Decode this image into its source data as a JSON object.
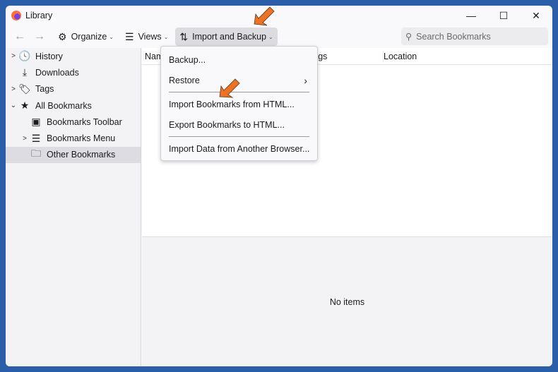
{
  "window": {
    "title": "Library",
    "min": "—",
    "max": "☐",
    "close": "✕"
  },
  "toolbar": {
    "back": "←",
    "forward": "→",
    "organize": "Organize",
    "views": "Views",
    "import_backup": "Import and Backup",
    "search_placeholder": "Search Bookmarks"
  },
  "sidebar": {
    "items": [
      {
        "label": "History",
        "icon": "clock-icon",
        "glyph": "🕓",
        "twisty": ">"
      },
      {
        "label": "Downloads",
        "icon": "download-icon",
        "glyph": "⤓",
        "twisty": ""
      },
      {
        "label": "Tags",
        "icon": "tag-icon",
        "glyph": "🏷",
        "twisty": ">"
      },
      {
        "label": "All Bookmarks",
        "icon": "star-icon",
        "glyph": "★",
        "twisty": "⌄"
      },
      {
        "label": "Bookmarks Toolbar",
        "icon": "toolbar-icon",
        "glyph": "▣",
        "twisty": ""
      },
      {
        "label": "Bookmarks Menu",
        "icon": "menu-icon",
        "glyph": "☰",
        "twisty": ">"
      },
      {
        "label": "Other Bookmarks",
        "icon": "folder-icon",
        "glyph": "🗀",
        "twisty": ""
      }
    ]
  },
  "columns": {
    "name": "Name",
    "tags": "Tags",
    "location": "Location"
  },
  "details": {
    "empty": "No items"
  },
  "menu": {
    "backup": "Backup...",
    "restore": "Restore",
    "restore_sub": "›",
    "import_html": "Import Bookmarks from HTML...",
    "export_html": "Export Bookmarks to HTML...",
    "import_browser": "Import Data from Another Browser..."
  },
  "colors": {
    "annotation_arrow": "#ee7223",
    "frame": "#2a5ea8"
  }
}
